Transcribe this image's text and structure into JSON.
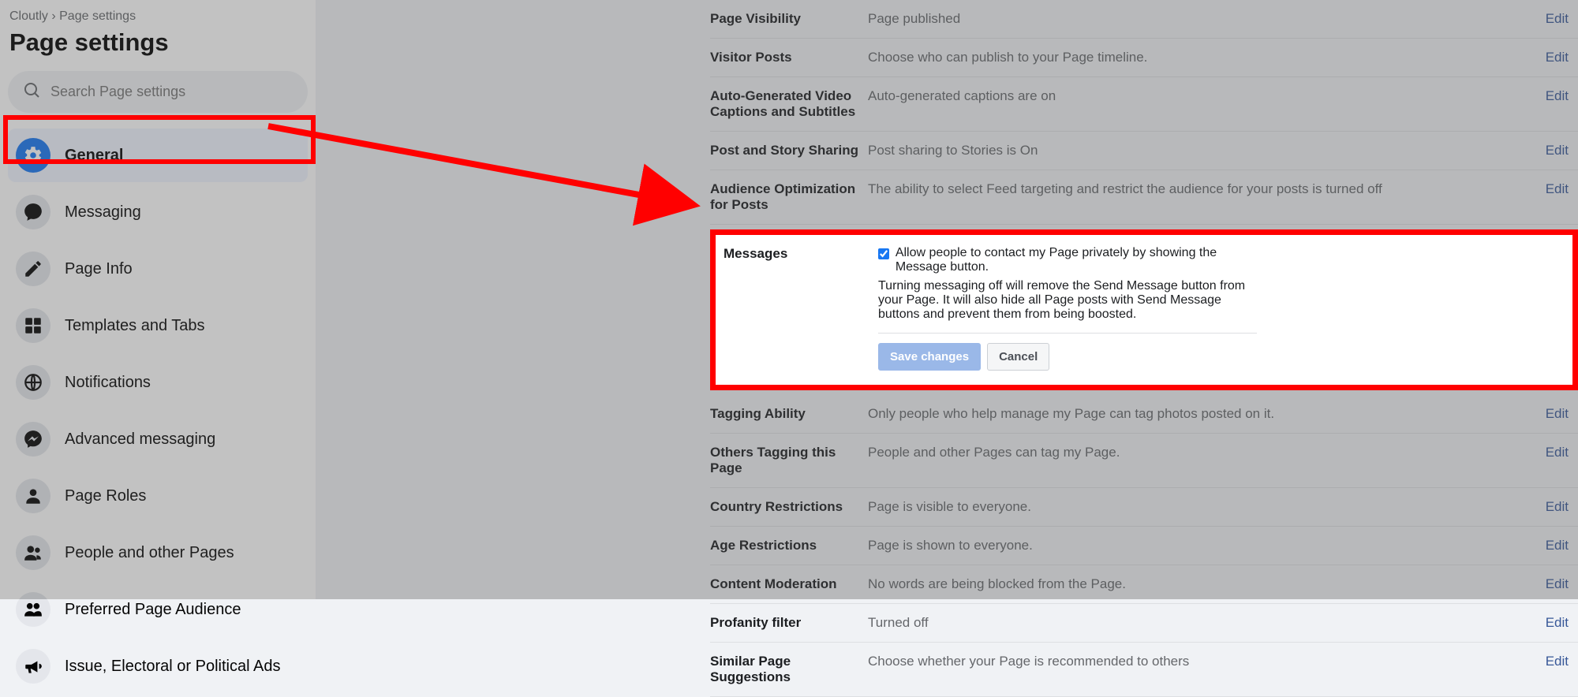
{
  "breadcrumb": "Cloutly › Page settings",
  "page_title": "Page settings",
  "search": {
    "placeholder": "Search Page settings"
  },
  "nav": [
    {
      "label": "General"
    },
    {
      "label": "Messaging"
    },
    {
      "label": "Page Info"
    },
    {
      "label": "Templates and Tabs"
    },
    {
      "label": "Notifications"
    },
    {
      "label": "Advanced messaging"
    },
    {
      "label": "Page Roles"
    },
    {
      "label": "People and other Pages"
    },
    {
      "label": "Preferred Page Audience"
    },
    {
      "label": "Issue, Electoral or Political Ads"
    }
  ],
  "rows": {
    "page_visibility": {
      "label": "Page Visibility",
      "value": "Page published",
      "edit": "Edit"
    },
    "visitor_posts": {
      "label": "Visitor Posts",
      "value": "Choose who can publish to your Page timeline.",
      "edit": "Edit"
    },
    "auto_captions": {
      "label": "Auto-Generated Video Captions and Subtitles",
      "value": "Auto-generated captions are on",
      "edit": "Edit"
    },
    "post_sharing": {
      "label": "Post and Story Sharing",
      "value": "Post sharing to Stories is On",
      "edit": "Edit"
    },
    "audience_opt": {
      "label": "Audience Optimization for Posts",
      "value": "The ability to select Feed targeting and restrict the audience for your posts is turned off",
      "edit": "Edit"
    },
    "tagging": {
      "label": "Tagging Ability",
      "value": "Only people who help manage my Page can tag photos posted on it.",
      "edit": "Edit"
    },
    "others_tagging": {
      "label": "Others Tagging this Page",
      "value": "People and other Pages can tag my Page.",
      "edit": "Edit"
    },
    "country": {
      "label": "Country Restrictions",
      "value": "Page is visible to everyone.",
      "edit": "Edit"
    },
    "age": {
      "label": "Age Restrictions",
      "value": "Page is shown to everyone.",
      "edit": "Edit"
    },
    "moderation": {
      "label": "Content Moderation",
      "value": "No words are being blocked from the Page.",
      "edit": "Edit"
    },
    "profanity": {
      "label": "Profanity filter",
      "value": "Turned off",
      "edit": "Edit"
    },
    "similar": {
      "label": "Similar Page Suggestions",
      "value": "Choose whether your Page is recommended to others",
      "edit": "Edit"
    }
  },
  "messages": {
    "label": "Messages",
    "checkbox_text": "Allow people to contact my Page privately by showing the Message button.",
    "note": "Turning messaging off will remove the Send Message button from your Page. It will also hide all Page posts with Send Message buttons and prevent them from being boosted.",
    "save": "Save changes",
    "cancel": "Cancel"
  }
}
